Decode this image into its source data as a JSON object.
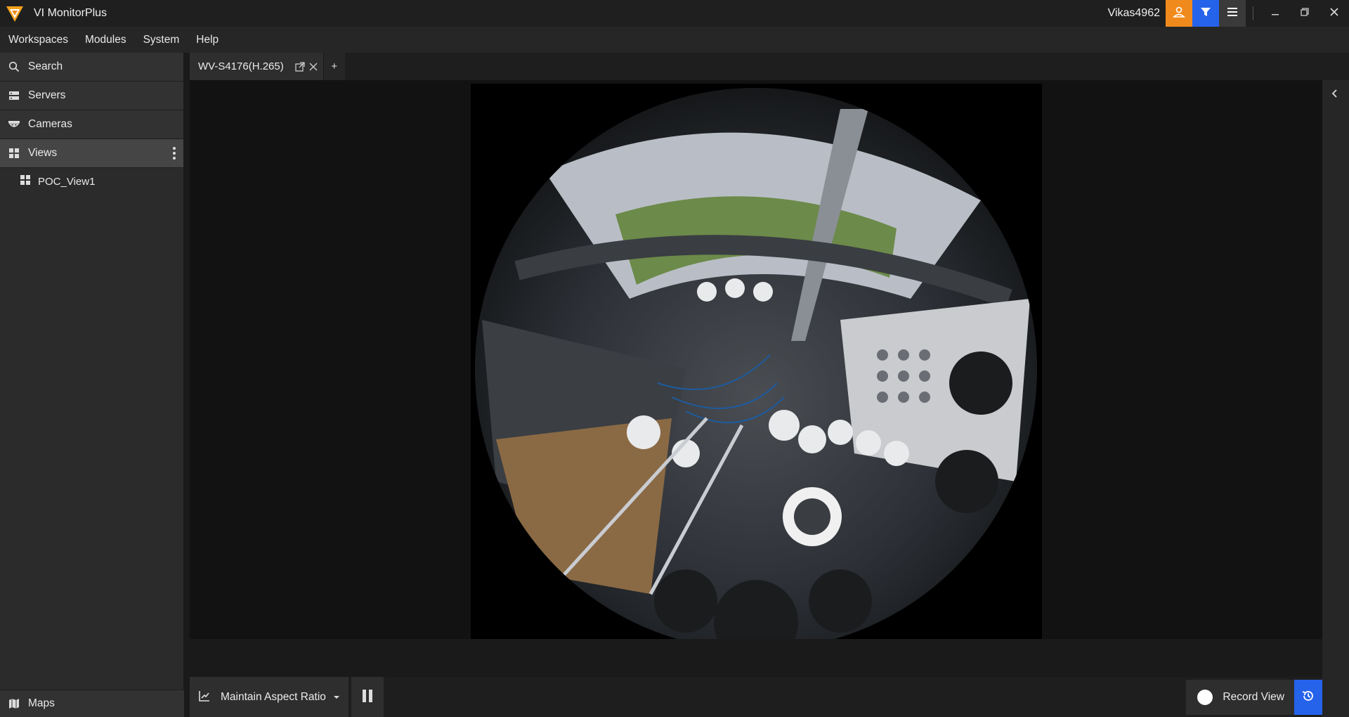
{
  "app": {
    "title": "VI MonitorPlus",
    "username": "Vikas4962"
  },
  "menu": [
    "Workspaces",
    "Modules",
    "System",
    "Help"
  ],
  "sidebar": {
    "search": "Search",
    "servers": "Servers",
    "cameras": "Cameras",
    "views": "Views",
    "view_items": [
      "POC_View1"
    ],
    "maps": "Maps"
  },
  "tabs": [
    {
      "label": "WV-S4176(H.265)"
    }
  ],
  "tab_add": "+",
  "bottom": {
    "aspect_label": "Maintain Aspect Ratio",
    "record_label": "Record View"
  },
  "colors": {
    "accent_orange": "#f08a1c",
    "accent_blue": "#2563eb"
  },
  "icons": [
    "app-logo-icon",
    "user-icon",
    "filter-icon",
    "menu-icon",
    "minimize-icon",
    "restore-icon",
    "close-icon",
    "search-icon",
    "servers-icon",
    "cameras-icon",
    "views-icon",
    "kebab-icon",
    "maps-icon",
    "popout-icon",
    "chart-icon",
    "dropdown-icon",
    "pause-icon",
    "history-icon",
    "chevron-left-icon"
  ]
}
